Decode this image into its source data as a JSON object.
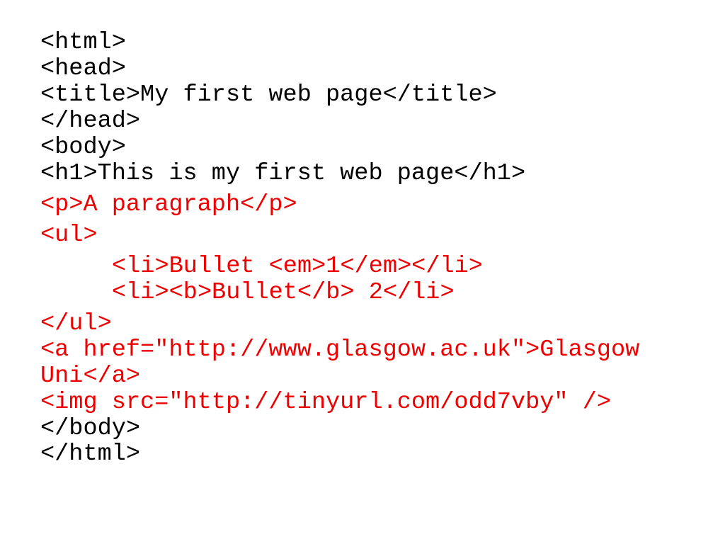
{
  "slide": {
    "code_lines": [
      {
        "text": "<html>",
        "color": "black"
      },
      {
        "text": "<head>",
        "color": "black"
      },
      {
        "text": "<title>My first web page</title>",
        "color": "black"
      },
      {
        "text": "</head>",
        "color": "black"
      },
      {
        "text": "<body>",
        "color": "black"
      },
      {
        "text": "<h1>This is my first web page</h1>",
        "color": "black"
      },
      {
        "text": "<p>A paragraph</p>",
        "color": "red"
      },
      {
        "text": "<ul>",
        "color": "red"
      },
      {
        "text": "<li>Bullet <em>1</em></li>",
        "color": "red",
        "indented": true
      },
      {
        "text": "<li><b>Bullet</b> 2</li>",
        "color": "red",
        "indented": true
      },
      {
        "text": "</ul>",
        "color": "red"
      },
      {
        "text": "<a href=\"http://www.glasgow.ac.uk\">Glasgow",
        "color": "red"
      },
      {
        "text": "Uni</a>",
        "color": "red"
      },
      {
        "text": "<img src=\"http://tinyurl.com/odd7vby\" />",
        "color": "red"
      },
      {
        "text": "</body>",
        "color": "black"
      },
      {
        "text": "</html>",
        "color": "black"
      }
    ]
  },
  "colors": {
    "default_text": "#000000",
    "highlight_text": "#ee0000",
    "background": "#ffffff"
  }
}
